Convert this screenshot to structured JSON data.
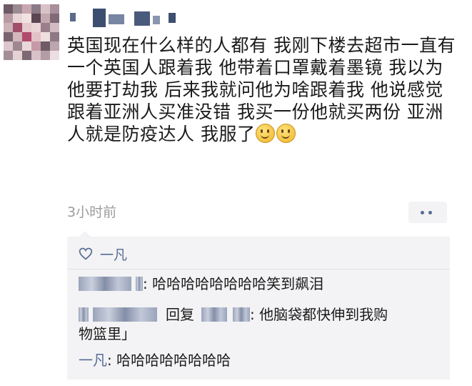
{
  "post": {
    "author_name": "",
    "body": "英国现在什么样的人都有 我刚下楼去超市一直有一个英国人跟着我 他带着口罩戴着墨镜 我以为他要打劫我 后来我就问他为啥跟着我 他说感觉跟着亚洲人买准没错 我买一份他就买两份 亚洲人就是防疫达人 我服了",
    "emoji": [
      "smile-emoji",
      "smile-emoji"
    ],
    "time": "3小时前",
    "more_icon": "more-dots-icon"
  },
  "likes": {
    "icon": "heart-outline-icon",
    "names": "一凡"
  },
  "comments": [
    {
      "text": ": 哈哈哈哈哈哈哈哈笑到飙泪"
    },
    {
      "reply_word": "回复",
      "text_line1": ": 他脑袋都快伸到我购",
      "text_line2": "物篮里」"
    },
    {
      "author": "一凡",
      "text": ": 哈哈哈哈哈哈哈哈"
    }
  ],
  "colors": {
    "link": "#576b95",
    "panel_bg": "#f3f3f5",
    "meta_text": "#9b9b9b"
  }
}
